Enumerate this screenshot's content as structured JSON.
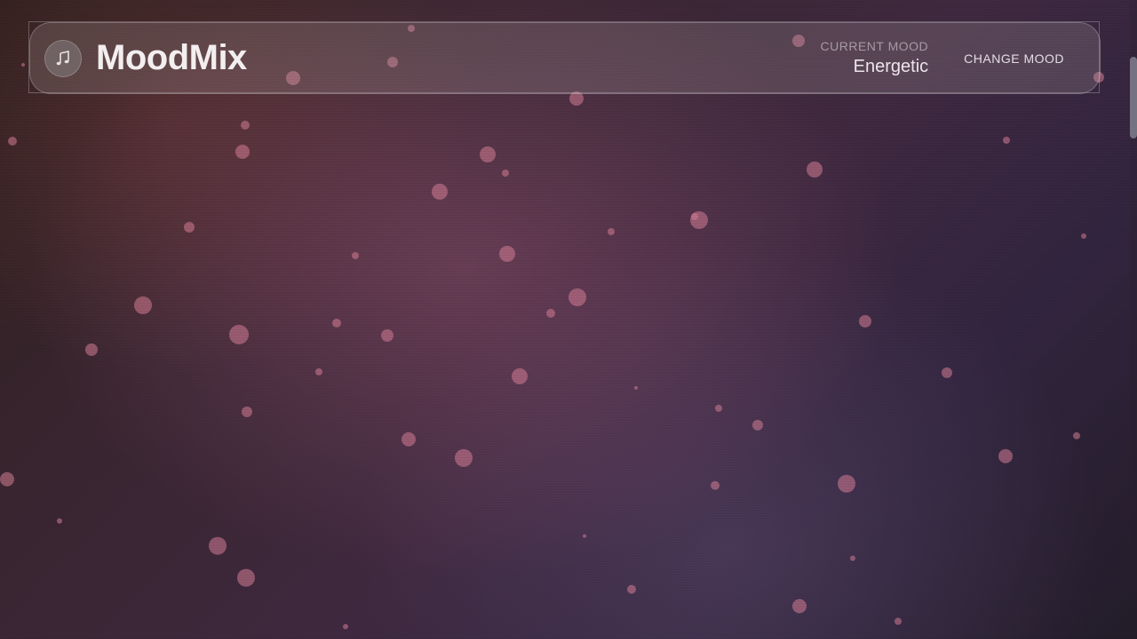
{
  "header": {
    "app_name": "MoodMix",
    "logo_icon": "music-note-icon",
    "current_mood_label": "Current Mood",
    "current_mood_value": "Energetic",
    "change_mood_label": "CHANGE MOOD"
  },
  "colors": {
    "particle": "#d67d96",
    "background_dark": "#231d2a",
    "background_mid": "#3f2940"
  }
}
